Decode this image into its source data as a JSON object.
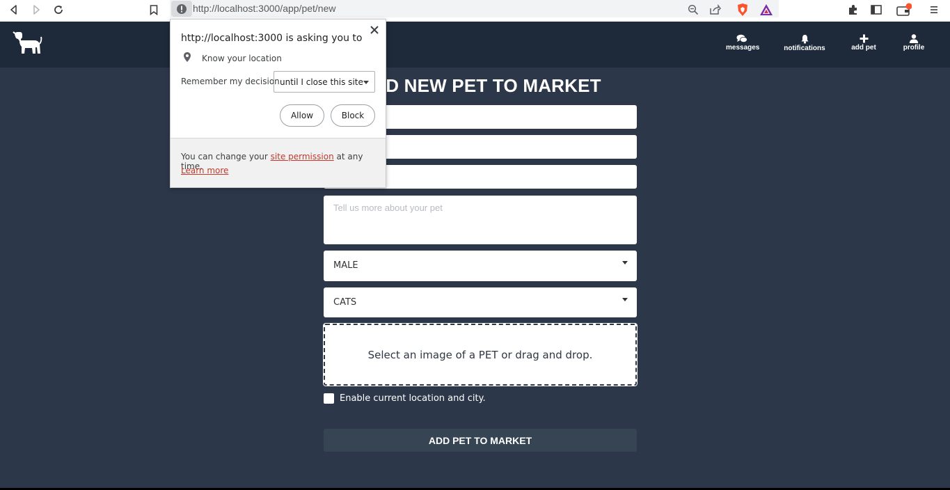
{
  "browser": {
    "url": "http://localhost:3000/app/pet/new"
  },
  "header": {
    "nav": [
      {
        "label": "messages",
        "icon": "comments-icon"
      },
      {
        "label": "notifications",
        "icon": "bell-icon"
      },
      {
        "label": "add pet",
        "icon": "plus-icon"
      },
      {
        "label": "profile",
        "icon": "user-icon"
      }
    ]
  },
  "form": {
    "title": "ADD NEW PET TO MARKET",
    "description_placeholder": "Tell us more about your pet",
    "gender_value": "MALE",
    "category_value": "CATS",
    "dropzone_text": "Select an image of a PET or drag and drop.",
    "location_checkbox_label": "Enable current location and city.",
    "submit_label": "ADD PET TO MARKET"
  },
  "permission_popup": {
    "title": "http://localhost:3000 is asking you to",
    "permission": "Know your location",
    "remember_label": "Remember my decision",
    "remember_value": "until I close this site",
    "allow_label": "Allow",
    "block_label": "Block",
    "footer_prefix": "You can change your ",
    "footer_link": "site permission",
    "footer_suffix": " at any time.",
    "learn_more": "Learn more"
  },
  "colors": {
    "app_background": "#2c3749",
    "header_background": "#1e2a3a",
    "link_accent": "#c0392b"
  }
}
